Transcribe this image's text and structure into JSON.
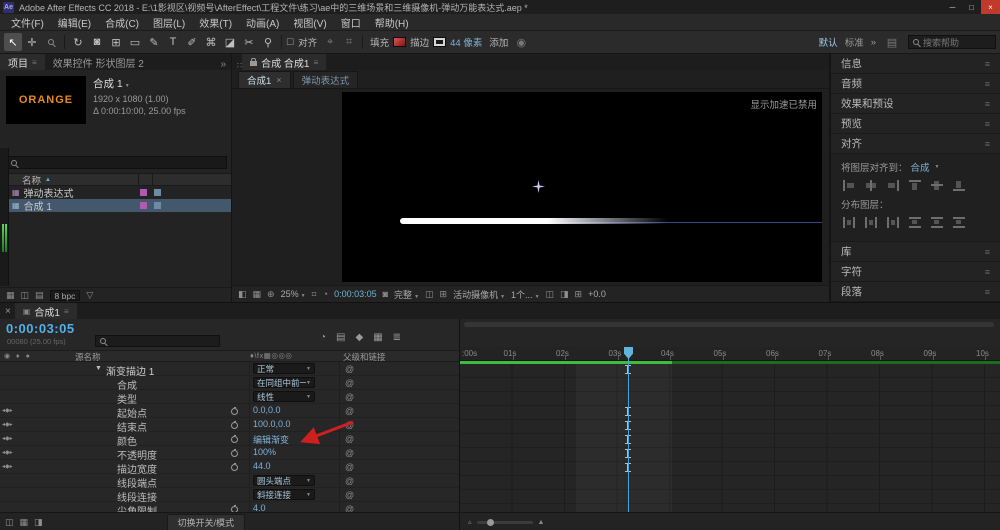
{
  "titlebar": {
    "app": "Ae",
    "title": "Adobe After Effects CC 2018 - E:\\1影视区\\视频号\\AfterEffect\\工程文件\\练习\\ae中的三维场景和三维摄像机-弹动万能表达式.aep *",
    "min": "─",
    "max": "□",
    "close": "×"
  },
  "menubar": [
    "文件(F)",
    "编辑(E)",
    "合成(C)",
    "图层(L)",
    "效果(T)",
    "动画(A)",
    "视图(V)",
    "窗口",
    "帮助(H)"
  ],
  "toolbar": {
    "snap": "对齐",
    "fill": "填充",
    "stroke": "描边",
    "stroke_width": "44 像素",
    "add": "添加",
    "workspace_active": "默认",
    "workspace_alt": "标准",
    "overflow": "»",
    "search_placeholder": "搜索帮助"
  },
  "project": {
    "tab": "项目",
    "tab2": "效果控件 形状图层 2",
    "overflow": "»",
    "comp_name": "合成 1",
    "thumb": "ORANGE",
    "dims": "1920 x 1080 (1.00)",
    "duration": "Δ 0:00:10:00, 25.00 fps",
    "col_name": "名称",
    "rows": [
      {
        "name": "弹动表达式",
        "selected": false
      },
      {
        "name": "合成 1",
        "selected": true
      }
    ],
    "bpc": "8 bpc"
  },
  "comp": {
    "panel_tab": "合成 合成1",
    "tabs": [
      "合成1",
      "弹动表达式"
    ],
    "notice": "显示加速已禁用",
    "zoom": "25%",
    "timecode": "0:00:03:05",
    "resolution": "完整",
    "view": "活动摄像机",
    "views": "1个...",
    "exposure": "+0.0"
  },
  "rightpanel": {
    "sections_top": [
      "信息",
      "音频",
      "效果和预设",
      "预览",
      "对齐"
    ],
    "sections_bottom": [
      "库",
      "字符",
      "段落"
    ],
    "align_to_label": "将图层对齐到：",
    "align_to_value": "合成",
    "distribute_label": "分布图层："
  },
  "timeline": {
    "tab": "合成1",
    "timecode": "0:00:03:05",
    "frames": "00080 (25.00 fps)",
    "col_source": "源名称",
    "col_parent": "父级和链接",
    "toggle": "切换开关/模式",
    "ruler": [
      ":00s",
      "01s",
      "02s",
      "03s",
      "04s",
      "05s",
      "06s",
      "07s",
      "08s",
      "09s",
      "10s"
    ],
    "rows": [
      {
        "name": "渐变描边 1",
        "value": "正常",
        "kind": "dropdown",
        "group": true,
        "kf": true
      },
      {
        "name": "合成",
        "value": "在同组中前一个之上",
        "kind": "dropdown"
      },
      {
        "name": "类型",
        "value": "线性",
        "kind": "dropdown"
      },
      {
        "name": "起始点",
        "value": "0.0,0.0",
        "kind": "value",
        "stopwatch": true,
        "kf": true,
        "nav": true
      },
      {
        "name": "结束点",
        "value": "100.0,0.0",
        "kind": "value",
        "stopwatch": true,
        "kf": true,
        "nav": true
      },
      {
        "name": "颜色",
        "value": "编辑渐变",
        "kind": "action",
        "stopwatch": true,
        "kf": true,
        "nav": true
      },
      {
        "name": "不透明度",
        "value": "100%",
        "kind": "value",
        "stopwatch": true,
        "kf": true,
        "nav": true
      },
      {
        "name": "描边宽度",
        "value": "44.0",
        "kind": "value",
        "stopwatch": true,
        "kf": true,
        "nav": true
      },
      {
        "name": "线段端点",
        "value": "圆头端点",
        "kind": "dropdown"
      },
      {
        "name": "线段连接",
        "value": "斜接连接",
        "kind": "dropdown"
      },
      {
        "name": "尖角限制",
        "value": "4.0",
        "kind": "value",
        "stopwatch": true
      }
    ]
  }
}
